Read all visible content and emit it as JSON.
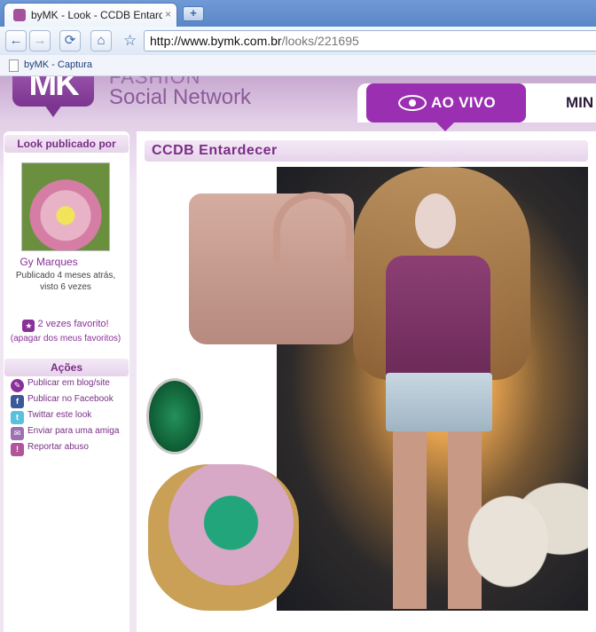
{
  "browser": {
    "tab_title": "byMK - Look - CCDB Entardecer",
    "tab_close": "×",
    "new_tab": "+",
    "url_host": "http://www.bymk.com.br",
    "url_path": "/looks/221695",
    "bookmark": "byMK - Captura"
  },
  "site": {
    "logo": "MK",
    "fashion": "FASHION",
    "social": "Social Network",
    "nav_live": "AO VIVO",
    "nav_min": "MIN"
  },
  "sidebar": {
    "published_by": "Look publicado por",
    "author": "Gy Marques",
    "published_line": "Publicado 4 meses atrás,",
    "seen_line": "visto 6 vezes",
    "favorites": "2 vezes favorito!",
    "remove_favorites": "(apagar dos meus favoritos)",
    "actions_title": "Ações",
    "actions": [
      {
        "label": "Publicar em blog/site",
        "icon": "blog-icon"
      },
      {
        "label": "Publicar no Facebook",
        "icon": "facebook-icon"
      },
      {
        "label": "Twittar este look",
        "icon": "twitter-icon"
      },
      {
        "label": "Enviar para uma amiga",
        "icon": "mail-icon"
      },
      {
        "label": "Reportar abuso",
        "icon": "abuse-icon"
      }
    ]
  },
  "look": {
    "title": "CCDB Entardecer"
  },
  "colors": {
    "accent": "#9b2fb2",
    "heading": "#7a2d86",
    "link": "#8a3099"
  }
}
